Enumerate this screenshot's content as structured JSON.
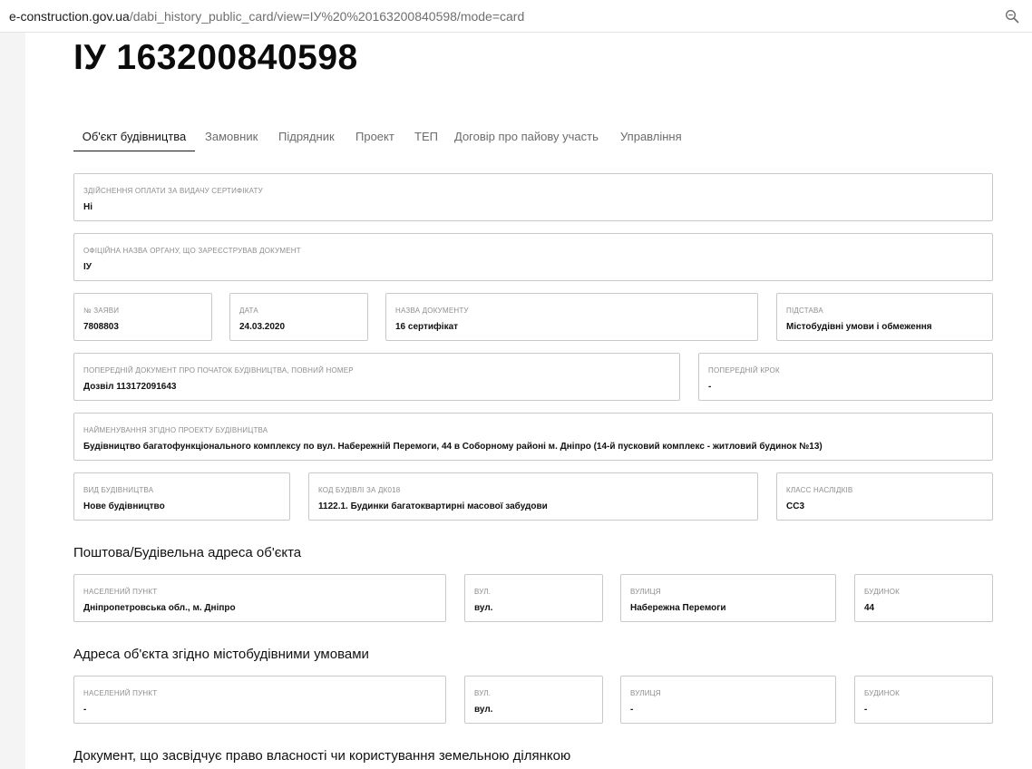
{
  "browser": {
    "url_host": "e-construction.gov.ua",
    "url_path": "/dabi_history_public_card/view=ІУ%20%20163200840598/mode=card",
    "zoom_icon": "magnifier-icon"
  },
  "page": {
    "title": "ІУ 163200840598",
    "tabs": [
      {
        "label": "Об'єкт будівництва",
        "active": true
      },
      {
        "label": "Замовник"
      },
      {
        "label": "Підрядник"
      },
      {
        "label": "Проект"
      },
      {
        "label": "ТЕП"
      },
      {
        "label": "Договір про пайову участь"
      },
      {
        "label": "Управління"
      }
    ]
  },
  "fields": {
    "payment": {
      "label": "Здійснення оплати за видачу сертифікату",
      "value": "Ні"
    },
    "authority": {
      "label": "Офіційна назва органу, що зареєстрував документ",
      "value": "ІУ"
    },
    "app_no": {
      "label": "№ заяви",
      "value": "7808803"
    },
    "date": {
      "label": "Дата",
      "value": "24.03.2020"
    },
    "doc_name": {
      "label": "Назва документу",
      "value": "16 сертифікат"
    },
    "basis": {
      "label": "Підстава",
      "value": "Містобудівні умови і обмеження"
    },
    "prev_doc": {
      "label": "Попередній документ про початок будівництва, повний номер",
      "value": "Дозвіл 113172091643"
    },
    "prev_step": {
      "label": "Попередній крок",
      "value": "-"
    },
    "project_name": {
      "label": "Найменування згідно проекту будівництва",
      "value": "Будівництво багатофункціонального комплексу по вул. Набережній Перемоги, 44 в Соборному районі м. Дніпро (14-й пусковий комплекс - житловий будинок №13)"
    },
    "build_type": {
      "label": "Вид будівництва",
      "value": "Нове будівництво"
    },
    "building_code": {
      "label": "Код будівлі за ДК018",
      "value": "1122.1. Будинки багатоквартирні масової забудови"
    },
    "consequence_class": {
      "label": "Класс наслідків",
      "value": "СС3"
    }
  },
  "postal_address": {
    "heading": "Поштова/Будівельна адреса об'єкта",
    "settlement": {
      "label": "Населений пункт",
      "value": "Дніпропетровська обл., м. Дніпро"
    },
    "street_type": {
      "label": "Вул.",
      "value": "вул."
    },
    "street": {
      "label": "Вулиця",
      "value": "Набережна Перемоги"
    },
    "house": {
      "label": "Будинок",
      "value": "44"
    }
  },
  "planning_address": {
    "heading": "Адреса об'єкта згідно містобудівними умовами",
    "settlement": {
      "label": "Населений пункт",
      "value": "-"
    },
    "street_type": {
      "label": "Вул.",
      "value": "вул."
    },
    "street": {
      "label": "Вулиця",
      "value": "-"
    },
    "house": {
      "label": "Будинок",
      "value": "-"
    }
  },
  "land_doc": {
    "heading": "Документ, що засвідчує право власності чи користування земельною ділянкою"
  }
}
